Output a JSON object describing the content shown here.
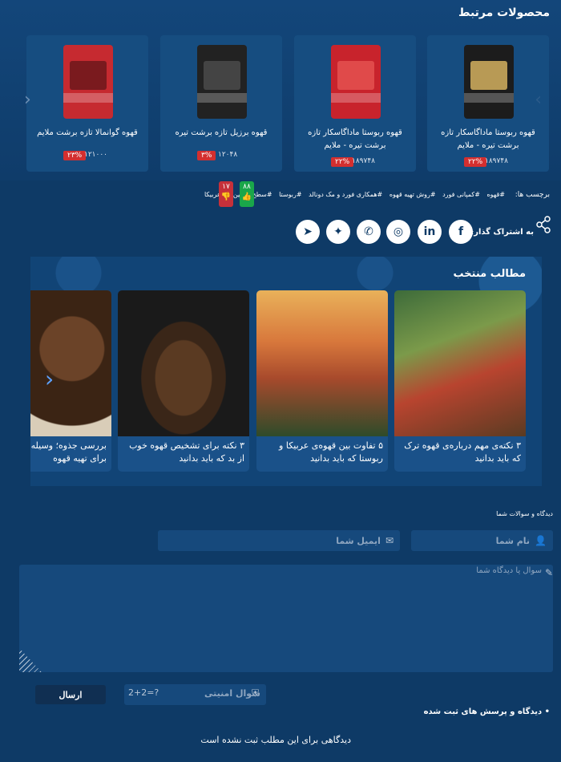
{
  "related": {
    "title": "محصولات مرتبط",
    "products": [
      {
        "name": "قهوه ربوستا ماداگاسکار تازه برشت تیره - ملایم",
        "discount": "۲۲%",
        "price": "۱۸۹۷۴۸",
        "pkg_color": "#1c1c1c"
      },
      {
        "name": "قهوه ربوستا ماداگاسکار تازه برشت تیره - ملایم",
        "discount": "۲۲%",
        "price": "۱۸۹۷۴۸",
        "pkg_color": "#c8232c"
      },
      {
        "name": "قهوه برزیل تازه برشت تیره",
        "discount": "۳%",
        "price": "۱۲۰۴۸",
        "pkg_color": "#222222"
      },
      {
        "name": "قهوه گوانمالا تازه برشت ملایم",
        "discount": "۲۳%",
        "price": "۱۲۱۰۰۰",
        "pkg_color": "#c62a30"
      }
    ],
    "prev_icon": "chevron-left-icon",
    "next_icon": "chevron-right-icon"
  },
  "tags": {
    "label": "برچسب ها:",
    "items": [
      "#قهوه",
      "#کمپانی فورد",
      "#روش تهیه قهوه",
      "#همکاری فورد و مک دونالد",
      "#ربوستا",
      "#سطح کافئین",
      "#عربیکا"
    ]
  },
  "votes": {
    "likes": "۸۸",
    "dislikes": "۱۷"
  },
  "share": {
    "label": "به اشتراک گذاری:",
    "networks": [
      {
        "name": "facebook",
        "glyph": "f"
      },
      {
        "name": "linkedin",
        "glyph": "in"
      },
      {
        "name": "instagram",
        "glyph": "◎"
      },
      {
        "name": "whatsapp",
        "glyph": "✆"
      },
      {
        "name": "twitter",
        "glyph": "✦"
      },
      {
        "name": "telegram",
        "glyph": "➤"
      }
    ]
  },
  "featured": {
    "title": "مطالب منتخب",
    "posts": [
      {
        "title": "۳ نکته‌ی مهم درباره‌ی قهوه ترک که باید بدانید"
      },
      {
        "title": "۵ تفاوت بین قهوه‌ی عربیکا و ربوستا که باید بدانید"
      },
      {
        "title": "۳ نکته برای تشخیص قهوه خوب از بد که باید بدانید"
      },
      {
        "title": "بررسی جذوه؛ وسیله‌ای کلاسیک برای تهیه قهوه"
      }
    ]
  },
  "comment_form": {
    "heading": "دیدگاه و سوالات شما",
    "name_placeholder": "نام شما",
    "email_placeholder": "ایمیل شما",
    "message_placeholder": "سوال یا دیدگاه شما",
    "captcha_label": "سوال امنیتی",
    "captcha_question": "2+2=?",
    "submit_label": "ارسال"
  },
  "comments": {
    "title": "• دیدگاه و پرسش های ثبت شده",
    "empty_text": "دیدگاهی برای این مطلب ثبت نشده است"
  }
}
